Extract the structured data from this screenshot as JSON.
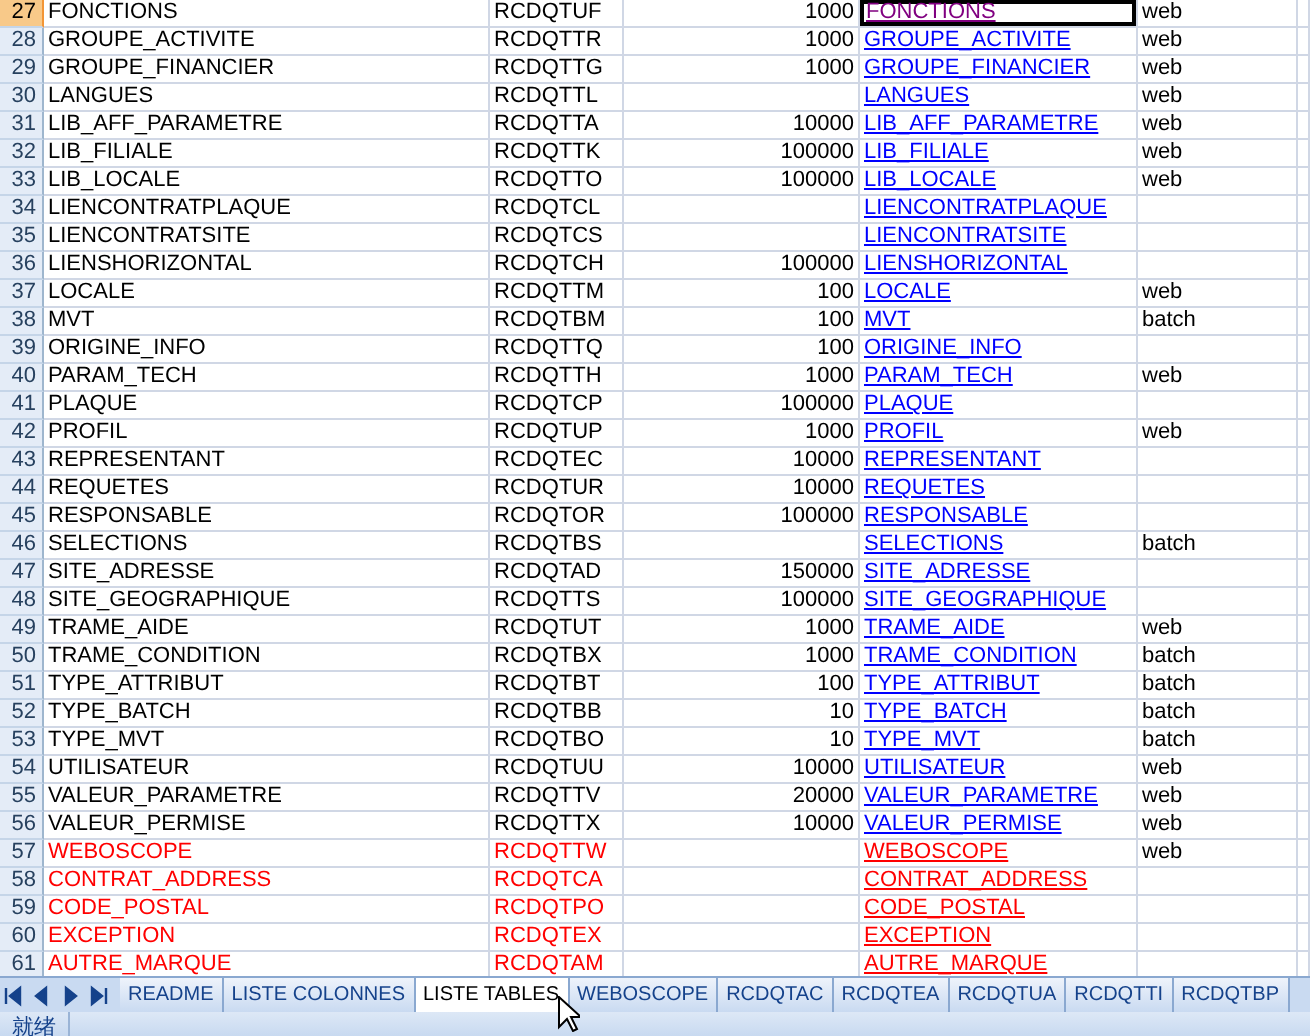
{
  "rows": [
    {
      "num": "27",
      "name": "FONCTIONS",
      "code": "RCDQTUF",
      "volume": "1000",
      "link": "FONCTIONS",
      "mode": "web",
      "flagged": false,
      "visited": true,
      "selected": true
    },
    {
      "num": "28",
      "name": "GROUPE_ACTIVITE",
      "code": "RCDQTTR",
      "volume": "1000",
      "link": "GROUPE_ACTIVITE",
      "mode": "web",
      "flagged": false,
      "visited": false,
      "selected": false
    },
    {
      "num": "29",
      "name": "GROUPE_FINANCIER",
      "code": "RCDQTTG",
      "volume": "1000",
      "link": "GROUPE_FINANCIER",
      "mode": "web",
      "flagged": false,
      "visited": false,
      "selected": false
    },
    {
      "num": "30",
      "name": "LANGUES",
      "code": "RCDQTTL",
      "link": "LANGUES",
      "mode": "web",
      "flagged": false,
      "visited": false,
      "selected": false
    },
    {
      "num": "31",
      "name": "LIB_AFF_PARAMETRE",
      "code": "RCDQTTA",
      "volume": "10000",
      "link": "LIB_AFF_PARAMETRE",
      "mode": "web",
      "flagged": false,
      "visited": false,
      "selected": false
    },
    {
      "num": "32",
      "name": "LIB_FILIALE",
      "code": "RCDQTTK",
      "volume": "100000",
      "link": "LIB_FILIALE",
      "mode": "web",
      "flagged": false,
      "visited": false,
      "selected": false
    },
    {
      "num": "33",
      "name": "LIB_LOCALE",
      "code": "RCDQTTO",
      "volume": "100000",
      "link": "LIB_LOCALE",
      "mode": "web",
      "flagged": false,
      "visited": false,
      "selected": false
    },
    {
      "num": "34",
      "name": "LIENCONTRATPLAQUE",
      "code": "RCDQTCL",
      "link": "LIENCONTRATPLAQUE",
      "flagged": false,
      "visited": false,
      "selected": false
    },
    {
      "num": "35",
      "name": "LIENCONTRATSITE",
      "code": "RCDQTCS",
      "link": "LIENCONTRATSITE",
      "flagged": false,
      "visited": false,
      "selected": false
    },
    {
      "num": "36",
      "name": "LIENSHORIZONTAL",
      "code": "RCDQTCH",
      "volume": "100000",
      "link": "LIENSHORIZONTAL",
      "flagged": false,
      "visited": false,
      "selected": false
    },
    {
      "num": "37",
      "name": "LOCALE",
      "code": "RCDQTTM",
      "volume": "100",
      "link": "LOCALE",
      "mode": "web",
      "flagged": false,
      "visited": false,
      "selected": false
    },
    {
      "num": "38",
      "name": "MVT",
      "code": "RCDQTBM",
      "volume": "100",
      "link": "MVT",
      "mode": "batch",
      "flagged": false,
      "visited": false,
      "selected": false
    },
    {
      "num": "39",
      "name": "ORIGINE_INFO",
      "code": "RCDQTTQ",
      "volume": "100",
      "link": "ORIGINE_INFO",
      "flagged": false,
      "visited": false,
      "selected": false
    },
    {
      "num": "40",
      "name": "PARAM_TECH",
      "code": "RCDQTTH",
      "volume": "1000",
      "link": "PARAM_TECH",
      "mode": "web",
      "flagged": false,
      "visited": false,
      "selected": false
    },
    {
      "num": "41",
      "name": "PLAQUE",
      "code": "RCDQTCP",
      "volume": "100000",
      "link": "PLAQUE",
      "flagged": false,
      "visited": false,
      "selected": false
    },
    {
      "num": "42",
      "name": "PROFIL",
      "code": "RCDQTUP",
      "volume": "1000",
      "link": "PROFIL",
      "mode": "web",
      "flagged": false,
      "visited": false,
      "selected": false
    },
    {
      "num": "43",
      "name": "REPRESENTANT",
      "code": "RCDQTEC",
      "volume": "10000",
      "link": "REPRESENTANT",
      "flagged": false,
      "visited": false,
      "selected": false
    },
    {
      "num": "44",
      "name": "REQUETES",
      "code": "RCDQTUR",
      "volume": "10000",
      "link": "REQUETES",
      "flagged": false,
      "visited": false,
      "selected": false
    },
    {
      "num": "45",
      "name": "RESPONSABLE",
      "code": "RCDQTOR",
      "volume": "100000",
      "link": "RESPONSABLE",
      "flagged": false,
      "visited": false,
      "selected": false
    },
    {
      "num": "46",
      "name": "SELECTIONS",
      "code": "RCDQTBS",
      "link": "SELECTIONS",
      "mode": "batch",
      "flagged": false,
      "visited": false,
      "selected": false
    },
    {
      "num": "47",
      "name": "SITE_ADRESSE",
      "code": "RCDQTAD",
      "volume": "150000",
      "link": "SITE_ADRESSE",
      "flagged": false,
      "visited": false,
      "selected": false
    },
    {
      "num": "48",
      "name": "SITE_GEOGRAPHIQUE",
      "code": "RCDQTTS",
      "volume": "100000",
      "link": "SITE_GEOGRAPHIQUE",
      "flagged": false,
      "visited": false,
      "selected": false
    },
    {
      "num": "49",
      "name": "TRAME_AIDE",
      "code": "RCDQTUT",
      "volume": "1000",
      "link": "TRAME_AIDE",
      "mode": "web",
      "flagged": false,
      "visited": false,
      "selected": false
    },
    {
      "num": "50",
      "name": "TRAME_CONDITION",
      "code": "RCDQTBX",
      "volume": "1000",
      "link": "TRAME_CONDITION",
      "mode": "batch",
      "flagged": false,
      "visited": false,
      "selected": false
    },
    {
      "num": "51",
      "name": "TYPE_ATTRIBUT",
      "code": "RCDQTBT",
      "volume": "100",
      "link": "TYPE_ATTRIBUT",
      "mode": "batch",
      "flagged": false,
      "visited": false,
      "selected": false
    },
    {
      "num": "52",
      "name": "TYPE_BATCH",
      "code": "RCDQTBB",
      "volume": "10",
      "link": "TYPE_BATCH",
      "mode": "batch",
      "flagged": false,
      "visited": false,
      "selected": false
    },
    {
      "num": "53",
      "name": "TYPE_MVT",
      "code": "RCDQTBO",
      "volume": "10",
      "link": "TYPE_MVT",
      "mode": "batch",
      "flagged": false,
      "visited": false,
      "selected": false
    },
    {
      "num": "54",
      "name": "UTILISATEUR",
      "code": "RCDQTUU",
      "volume": "10000",
      "link": "UTILISATEUR",
      "mode": "web",
      "flagged": false,
      "visited": false,
      "selected": false
    },
    {
      "num": "55",
      "name": "VALEUR_PARAMETRE",
      "code": "RCDQTTV",
      "volume": "20000",
      "link": "VALEUR_PARAMETRE",
      "mode": "web",
      "flagged": false,
      "visited": false,
      "selected": false
    },
    {
      "num": "56",
      "name": "VALEUR_PERMISE",
      "code": "RCDQTTX",
      "volume": "10000",
      "link": "VALEUR_PERMISE",
      "mode": "web",
      "flagged": false,
      "visited": false,
      "selected": false
    },
    {
      "num": "57",
      "name": "WEBOSCOPE",
      "code": "RCDQTTW",
      "link": "WEBOSCOPE",
      "mode": "web",
      "flagged": true,
      "visited": false,
      "selected": false
    },
    {
      "num": "58",
      "name": "CONTRAT_ADDRESS",
      "code": "RCDQTCA",
      "link": "CONTRAT_ADDRESS",
      "flagged": true,
      "visited": false,
      "selected": false
    },
    {
      "num": "59",
      "name": "CODE_POSTAL",
      "code": "RCDQTPO",
      "link": "CODE_POSTAL",
      "flagged": true,
      "visited": false,
      "selected": false
    },
    {
      "num": "60",
      "name": "EXCEPTION",
      "code": "RCDQTEX",
      "link": "EXCEPTION",
      "flagged": true,
      "visited": false,
      "selected": false
    },
    {
      "num": "61",
      "name": "AUTRE_MARQUE",
      "code": "RCDQTAM",
      "link": "AUTRE_MARQUE",
      "flagged": true,
      "visited": false,
      "selected": false
    }
  ],
  "sheet_tabs": [
    {
      "label": "README",
      "selected": false
    },
    {
      "label": "LISTE COLONNES",
      "selected": false
    },
    {
      "label": "LISTE TABLES",
      "selected": true
    },
    {
      "label": "WEBOSCOPE",
      "selected": false
    },
    {
      "label": "RCDQTAC",
      "selected": false
    },
    {
      "label": "RCDQTEA",
      "selected": false
    },
    {
      "label": "RCDQTUA",
      "selected": false
    },
    {
      "label": "RCDQTTI",
      "selected": false
    },
    {
      "label": "RCDQTBP",
      "selected": false
    }
  ],
  "status_bar": {
    "text": "就绪"
  }
}
